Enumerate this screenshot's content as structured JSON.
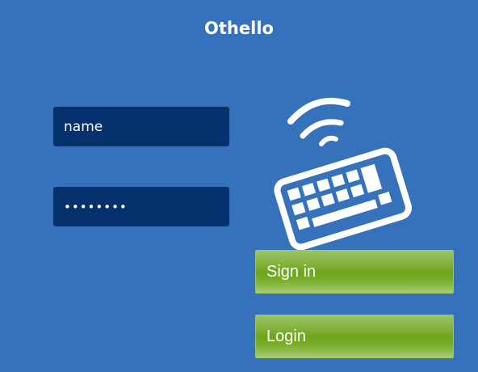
{
  "app": {
    "title": "Othello"
  },
  "form": {
    "username_value": "name",
    "password_masked": "••••••••"
  },
  "buttons": {
    "sign_in_label": "Sign in",
    "login_label": "Login"
  },
  "icons": {
    "keyboard": "wireless-keyboard-icon"
  },
  "colors": {
    "background": "#3672bb",
    "field": "#04306b",
    "button_green": "#6ea51b"
  }
}
